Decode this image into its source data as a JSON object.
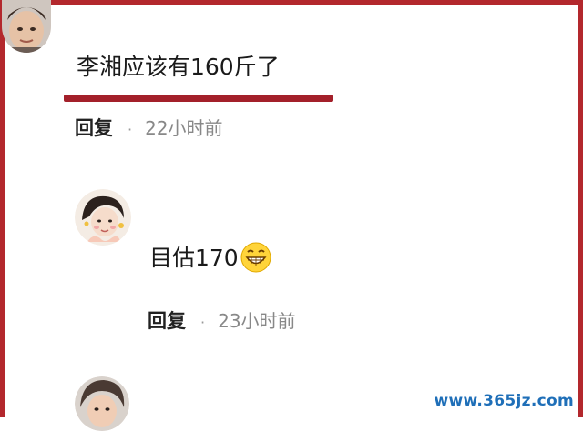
{
  "comments": [
    {
      "text": "李湘应该有160斤了",
      "reply_label": "回复",
      "separator": "·",
      "time": "22小时前",
      "highlight_color": "#a3202a"
    },
    {
      "text": "目估170",
      "emoji": "grinning-face-icon",
      "reply_label": "回复",
      "separator": "·",
      "time": "23小时前"
    }
  ],
  "watermark": "www.365jz.com",
  "colors": {
    "frame": "#b3282d",
    "time_gray": "#888888",
    "watermark_blue": "#1f6fb8"
  }
}
